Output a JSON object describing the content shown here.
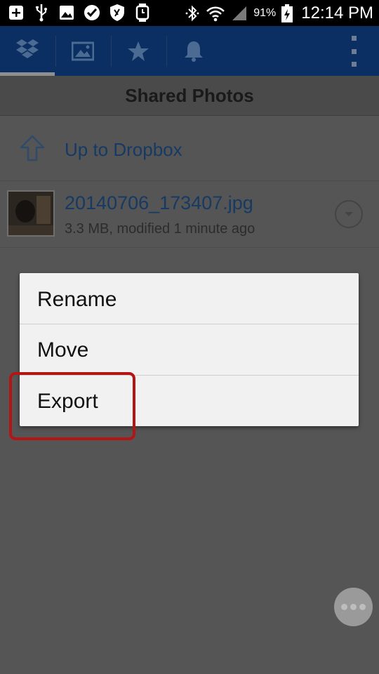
{
  "status_bar": {
    "battery_percent": "91%",
    "time": "12:14 PM",
    "left_icons": [
      "add-icon",
      "usb-icon",
      "image-icon",
      "check-icon",
      "shield-icon",
      "watch-icon"
    ],
    "right_icons": [
      "bluetooth-icon",
      "wifi-icon",
      "signal-icon",
      "battery-icon"
    ]
  },
  "toolbar": {
    "tabs": [
      {
        "name": "dropbox-icon",
        "active": true
      },
      {
        "name": "photos-icon",
        "active": false
      },
      {
        "name": "favorites-icon",
        "active": false
      },
      {
        "name": "notifications-icon",
        "active": false
      }
    ],
    "overflow": "more-icon"
  },
  "header": {
    "title": "Shared Photos"
  },
  "list": {
    "up_label": "Up to Dropbox",
    "file": {
      "name": "20140706_173407.jpg",
      "meta": "3.3 MB, modified 1 minute ago"
    }
  },
  "context_menu": {
    "items": [
      "Rename",
      "Move",
      "Export"
    ],
    "highlighted": "Export"
  },
  "colors": {
    "action_bar": "#0b2f63",
    "dim_background": "#555555",
    "menu_bg": "#f1f1f1",
    "highlight": "#b31414",
    "link_text": "#163a63"
  }
}
